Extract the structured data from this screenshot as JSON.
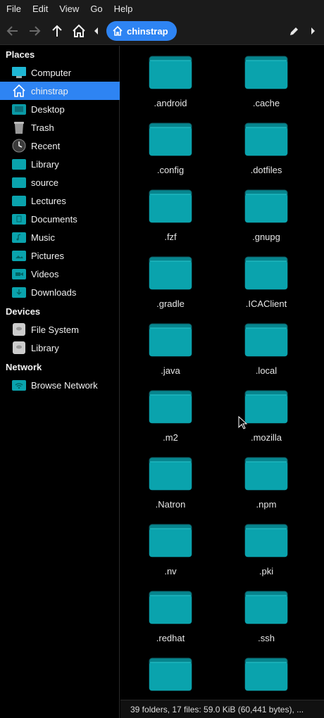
{
  "menu": [
    "File",
    "Edit",
    "View",
    "Go",
    "Help"
  ],
  "breadcrumb": "chinstrap",
  "sidebar": {
    "places_title": "Places",
    "places": [
      "Computer",
      "chinstrap",
      "Desktop",
      "Trash",
      "Recent",
      "Library",
      "source",
      "Lectures",
      "Documents",
      "Music",
      "Pictures",
      "Videos",
      "Downloads"
    ],
    "devices_title": "Devices",
    "devices": [
      "File System",
      "Library"
    ],
    "network_title": "Network",
    "network": [
      "Browse Network"
    ]
  },
  "folders": [
    ".android",
    ".cache",
    ".config",
    ".dotfiles",
    ".fzf",
    ".gnupg",
    ".gradle",
    ".ICAClient",
    ".java",
    ".local",
    ".m2",
    ".mozilla",
    ".Natron",
    ".npm",
    ".nv",
    ".pki",
    ".redhat",
    ".ssh",
    "",
    ""
  ],
  "status": "39 folders, 17 files: 59.0 KiB (60,441 bytes), ...",
  "colors": {
    "accent": "#2e84f3",
    "folder": "#0aa3ad"
  }
}
